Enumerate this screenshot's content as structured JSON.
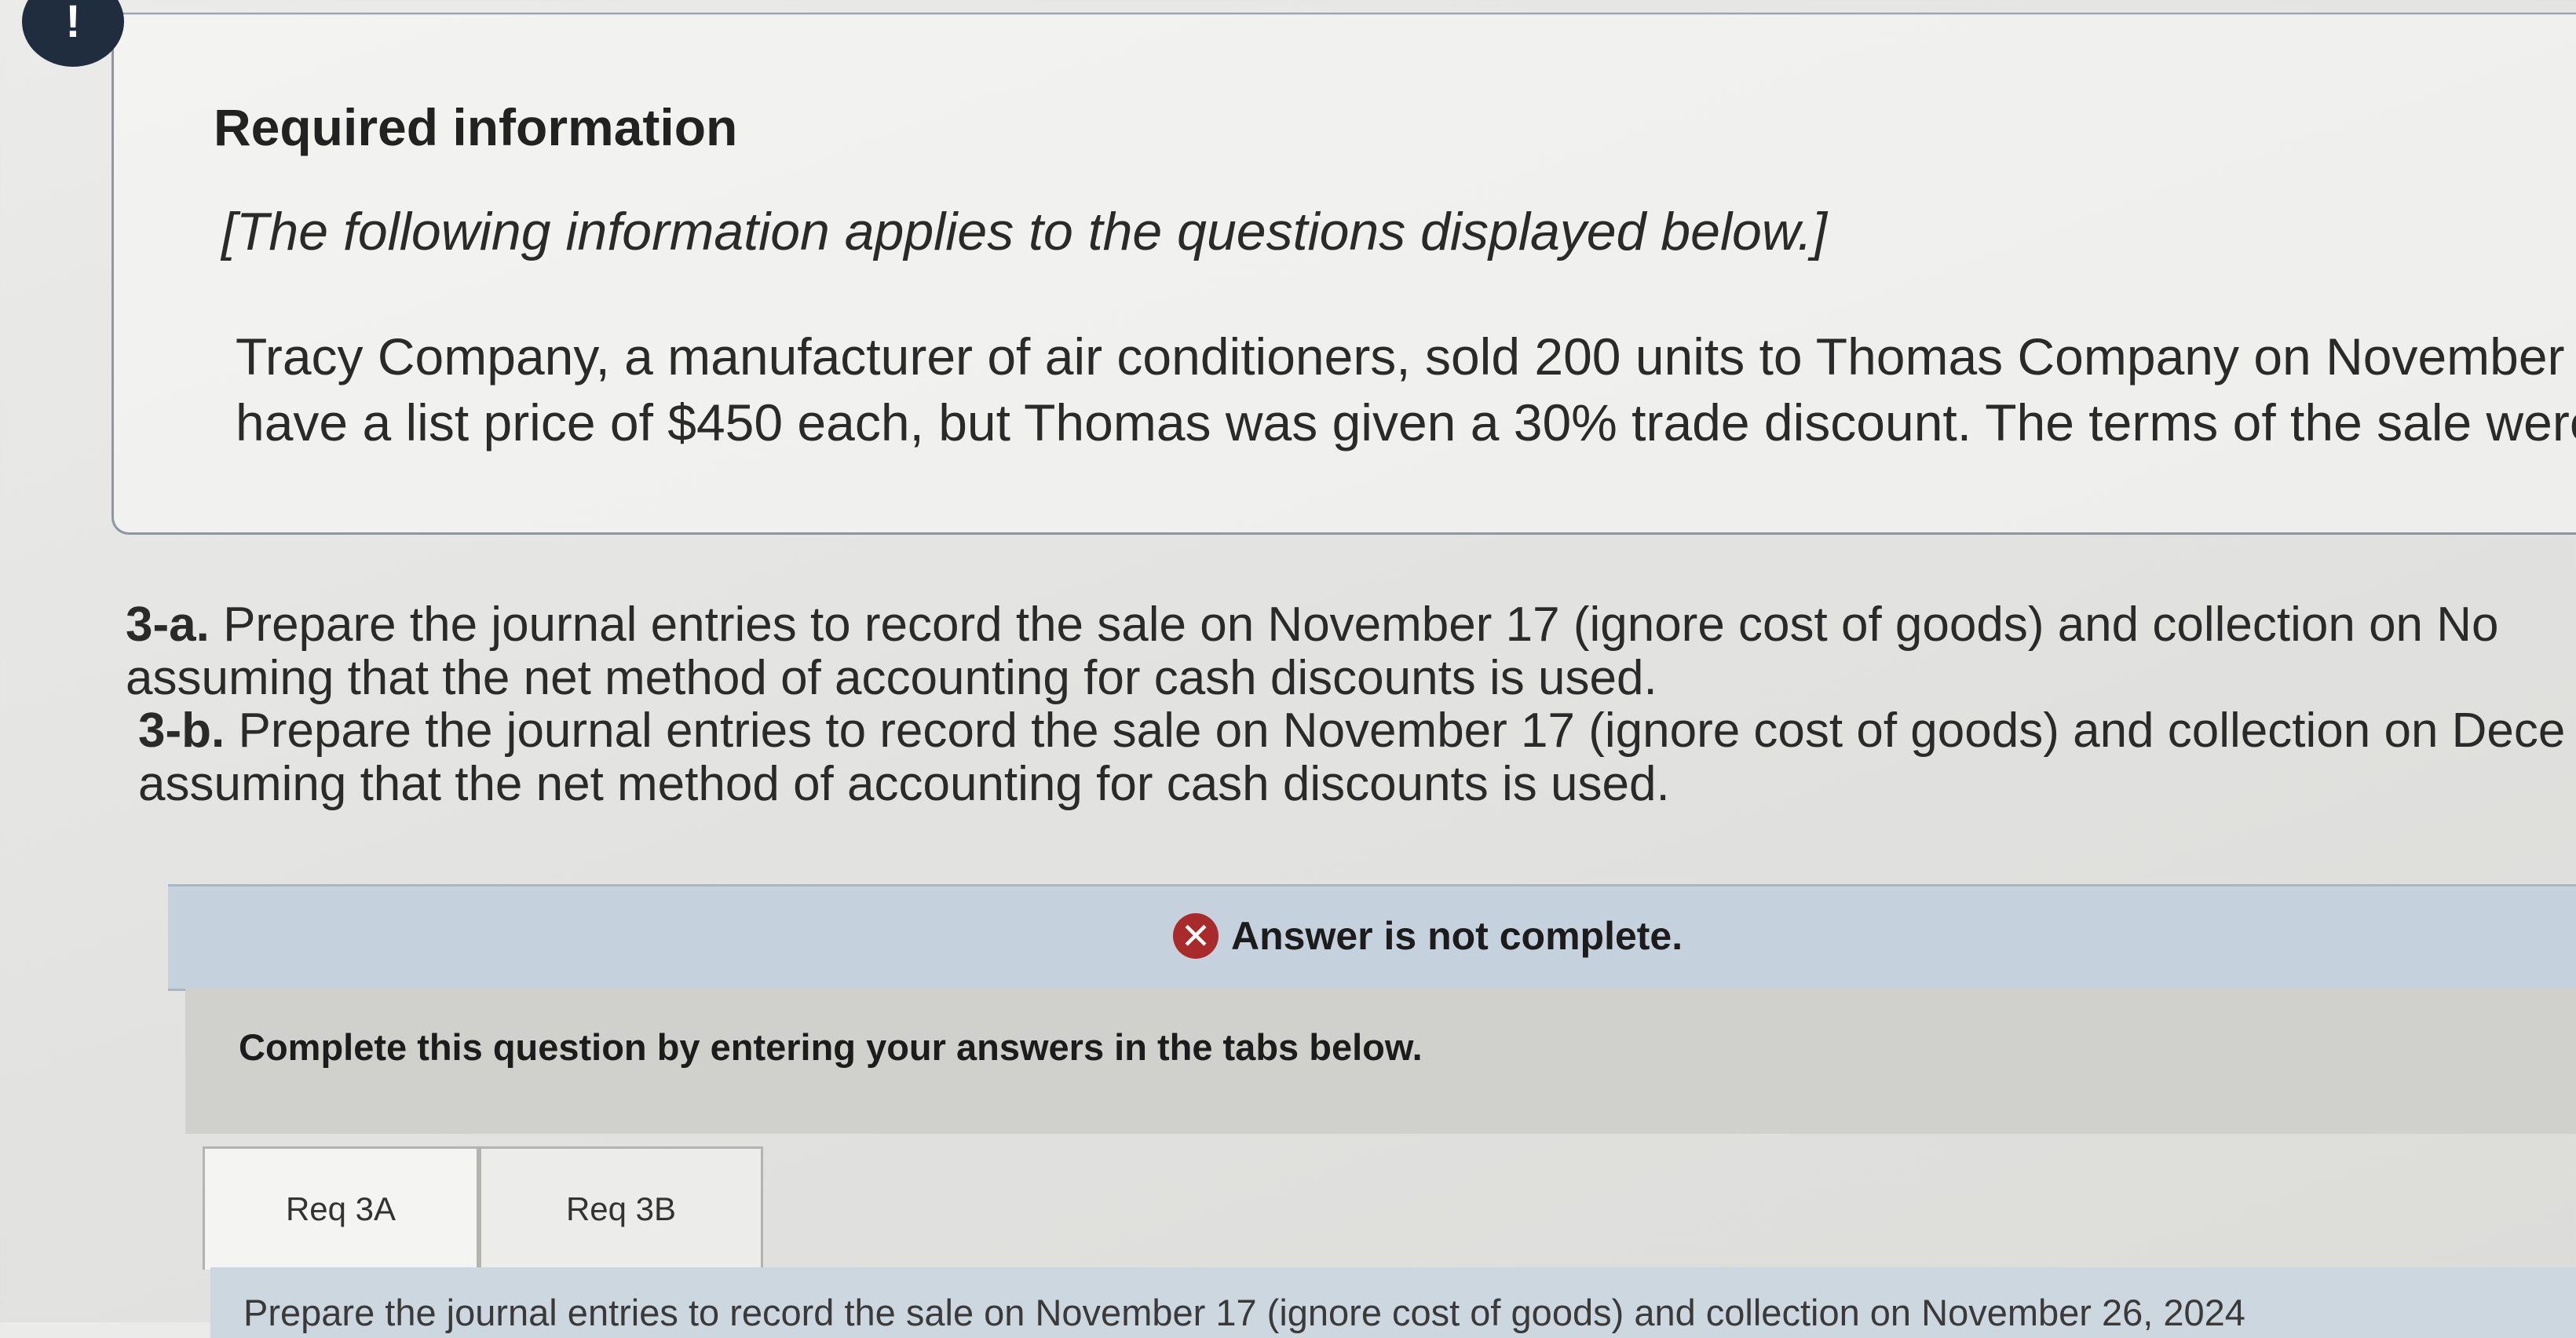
{
  "alert_badge": "!",
  "info": {
    "title": "Required information",
    "note": "[The following information applies to the questions displayed below.]",
    "body_lines": [
      "Tracy Company, a manufacturer of air conditioners, sold 200 units to Thomas Company on November",
      "have a list price of $450 each, but Thomas was given a 30% trade discount. The terms of the sale were"
    ]
  },
  "requirements": {
    "req_3a": {
      "tag": "3-a.",
      "line1": "Prepare the journal entries to record the sale on November 17 (ignore cost of goods) and collection on No",
      "line2": "assuming that the net method of accounting for cash discounts is used."
    },
    "req_3b": {
      "tag": "3-b.",
      "line1": "Prepare the journal entries to record the sale on November 17 (ignore cost of goods) and collection on Dece",
      "line2": "assuming that the net method of accounting for cash discounts is used."
    }
  },
  "status": {
    "icon": "✕",
    "icon_name": "error-x-icon",
    "text": "Answer is not complete.",
    "color": "#a92a2a"
  },
  "instruction": "Complete this question by entering your answers in the tabs below.",
  "tabs": [
    {
      "label": "Req 3A",
      "active": true
    },
    {
      "label": "Req 3B",
      "active": false
    }
  ],
  "tab_prompt": "Prepare the journal entries to record the sale on November 17 (ignore cost of goods) and collection on November 26, 2024"
}
